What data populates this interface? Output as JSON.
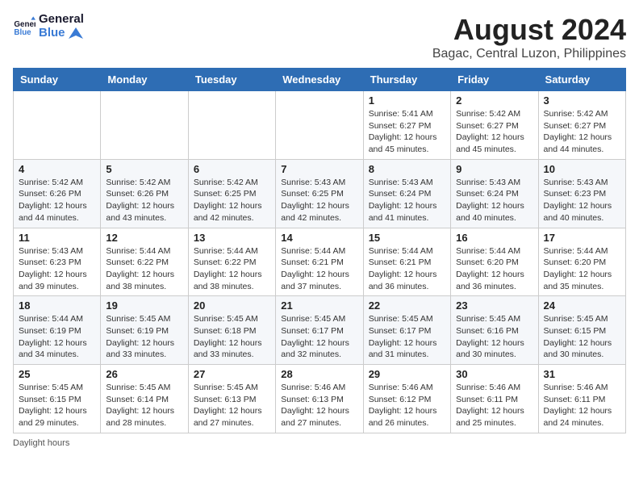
{
  "header": {
    "logo_line1": "General",
    "logo_line2": "Blue",
    "main_title": "August 2024",
    "subtitle": "Bagac, Central Luzon, Philippines"
  },
  "days_of_week": [
    "Sunday",
    "Monday",
    "Tuesday",
    "Wednesday",
    "Thursday",
    "Friday",
    "Saturday"
  ],
  "weeks": [
    [
      {
        "day": "",
        "sunrise": "",
        "sunset": "",
        "daylight": ""
      },
      {
        "day": "",
        "sunrise": "",
        "sunset": "",
        "daylight": ""
      },
      {
        "day": "",
        "sunrise": "",
        "sunset": "",
        "daylight": ""
      },
      {
        "day": "",
        "sunrise": "",
        "sunset": "",
        "daylight": ""
      },
      {
        "day": "1",
        "sunrise": "Sunrise: 5:41 AM",
        "sunset": "Sunset: 6:27 PM",
        "daylight": "Daylight: 12 hours and 45 minutes."
      },
      {
        "day": "2",
        "sunrise": "Sunrise: 5:42 AM",
        "sunset": "Sunset: 6:27 PM",
        "daylight": "Daylight: 12 hours and 45 minutes."
      },
      {
        "day": "3",
        "sunrise": "Sunrise: 5:42 AM",
        "sunset": "Sunset: 6:27 PM",
        "daylight": "Daylight: 12 hours and 44 minutes."
      }
    ],
    [
      {
        "day": "4",
        "sunrise": "Sunrise: 5:42 AM",
        "sunset": "Sunset: 6:26 PM",
        "daylight": "Daylight: 12 hours and 44 minutes."
      },
      {
        "day": "5",
        "sunrise": "Sunrise: 5:42 AM",
        "sunset": "Sunset: 6:26 PM",
        "daylight": "Daylight: 12 hours and 43 minutes."
      },
      {
        "day": "6",
        "sunrise": "Sunrise: 5:42 AM",
        "sunset": "Sunset: 6:25 PM",
        "daylight": "Daylight: 12 hours and 42 minutes."
      },
      {
        "day": "7",
        "sunrise": "Sunrise: 5:43 AM",
        "sunset": "Sunset: 6:25 PM",
        "daylight": "Daylight: 12 hours and 42 minutes."
      },
      {
        "day": "8",
        "sunrise": "Sunrise: 5:43 AM",
        "sunset": "Sunset: 6:24 PM",
        "daylight": "Daylight: 12 hours and 41 minutes."
      },
      {
        "day": "9",
        "sunrise": "Sunrise: 5:43 AM",
        "sunset": "Sunset: 6:24 PM",
        "daylight": "Daylight: 12 hours and 40 minutes."
      },
      {
        "day": "10",
        "sunrise": "Sunrise: 5:43 AM",
        "sunset": "Sunset: 6:23 PM",
        "daylight": "Daylight: 12 hours and 40 minutes."
      }
    ],
    [
      {
        "day": "11",
        "sunrise": "Sunrise: 5:43 AM",
        "sunset": "Sunset: 6:23 PM",
        "daylight": "Daylight: 12 hours and 39 minutes."
      },
      {
        "day": "12",
        "sunrise": "Sunrise: 5:44 AM",
        "sunset": "Sunset: 6:22 PM",
        "daylight": "Daylight: 12 hours and 38 minutes."
      },
      {
        "day": "13",
        "sunrise": "Sunrise: 5:44 AM",
        "sunset": "Sunset: 6:22 PM",
        "daylight": "Daylight: 12 hours and 38 minutes."
      },
      {
        "day": "14",
        "sunrise": "Sunrise: 5:44 AM",
        "sunset": "Sunset: 6:21 PM",
        "daylight": "Daylight: 12 hours and 37 minutes."
      },
      {
        "day": "15",
        "sunrise": "Sunrise: 5:44 AM",
        "sunset": "Sunset: 6:21 PM",
        "daylight": "Daylight: 12 hours and 36 minutes."
      },
      {
        "day": "16",
        "sunrise": "Sunrise: 5:44 AM",
        "sunset": "Sunset: 6:20 PM",
        "daylight": "Daylight: 12 hours and 36 minutes."
      },
      {
        "day": "17",
        "sunrise": "Sunrise: 5:44 AM",
        "sunset": "Sunset: 6:20 PM",
        "daylight": "Daylight: 12 hours and 35 minutes."
      }
    ],
    [
      {
        "day": "18",
        "sunrise": "Sunrise: 5:44 AM",
        "sunset": "Sunset: 6:19 PM",
        "daylight": "Daylight: 12 hours and 34 minutes."
      },
      {
        "day": "19",
        "sunrise": "Sunrise: 5:45 AM",
        "sunset": "Sunset: 6:19 PM",
        "daylight": "Daylight: 12 hours and 33 minutes."
      },
      {
        "day": "20",
        "sunrise": "Sunrise: 5:45 AM",
        "sunset": "Sunset: 6:18 PM",
        "daylight": "Daylight: 12 hours and 33 minutes."
      },
      {
        "day": "21",
        "sunrise": "Sunrise: 5:45 AM",
        "sunset": "Sunset: 6:17 PM",
        "daylight": "Daylight: 12 hours and 32 minutes."
      },
      {
        "day": "22",
        "sunrise": "Sunrise: 5:45 AM",
        "sunset": "Sunset: 6:17 PM",
        "daylight": "Daylight: 12 hours and 31 minutes."
      },
      {
        "day": "23",
        "sunrise": "Sunrise: 5:45 AM",
        "sunset": "Sunset: 6:16 PM",
        "daylight": "Daylight: 12 hours and 30 minutes."
      },
      {
        "day": "24",
        "sunrise": "Sunrise: 5:45 AM",
        "sunset": "Sunset: 6:15 PM",
        "daylight": "Daylight: 12 hours and 30 minutes."
      }
    ],
    [
      {
        "day": "25",
        "sunrise": "Sunrise: 5:45 AM",
        "sunset": "Sunset: 6:15 PM",
        "daylight": "Daylight: 12 hours and 29 minutes."
      },
      {
        "day": "26",
        "sunrise": "Sunrise: 5:45 AM",
        "sunset": "Sunset: 6:14 PM",
        "daylight": "Daylight: 12 hours and 28 minutes."
      },
      {
        "day": "27",
        "sunrise": "Sunrise: 5:45 AM",
        "sunset": "Sunset: 6:13 PM",
        "daylight": "Daylight: 12 hours and 27 minutes."
      },
      {
        "day": "28",
        "sunrise": "Sunrise: 5:46 AM",
        "sunset": "Sunset: 6:13 PM",
        "daylight": "Daylight: 12 hours and 27 minutes."
      },
      {
        "day": "29",
        "sunrise": "Sunrise: 5:46 AM",
        "sunset": "Sunset: 6:12 PM",
        "daylight": "Daylight: 12 hours and 26 minutes."
      },
      {
        "day": "30",
        "sunrise": "Sunrise: 5:46 AM",
        "sunset": "Sunset: 6:11 PM",
        "daylight": "Daylight: 12 hours and 25 minutes."
      },
      {
        "day": "31",
        "sunrise": "Sunrise: 5:46 AM",
        "sunset": "Sunset: 6:11 PM",
        "daylight": "Daylight: 12 hours and 24 minutes."
      }
    ]
  ],
  "footer": {
    "note": "Daylight hours"
  }
}
